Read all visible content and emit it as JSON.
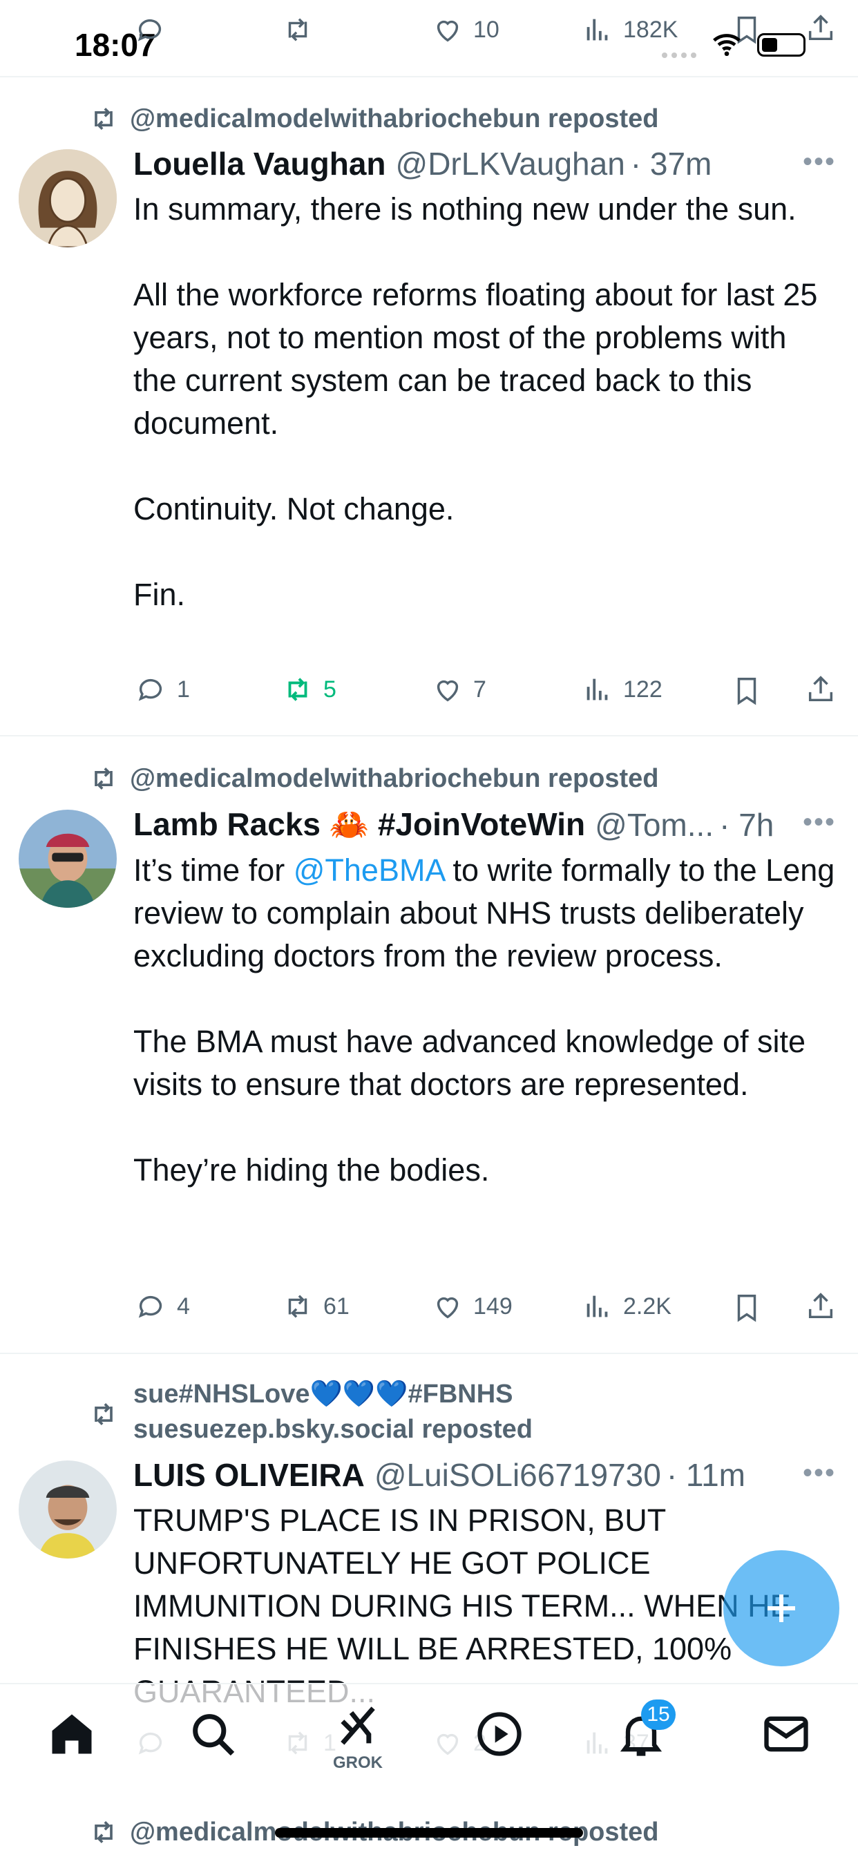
{
  "status_bar": {
    "time": "18:07"
  },
  "top_actions": {
    "likes": "10",
    "views": "182K"
  },
  "posts": [
    {
      "reposted_by": "@medicalmodelwithabriochebun reposted",
      "name": "Louella Vaughan",
      "handle": "@DrLKVaughan",
      "time": "· 37m",
      "text": "In summary, there is nothing new under the sun.\n\nAll the workforce reforms floating about for last 25 years, not to mention most of the problems with the current system can be traced back to this document.\n\nContinuity. Not change.\n\nFin.",
      "replies": "1",
      "reposts": "5",
      "likes": "7",
      "views": "122"
    },
    {
      "reposted_by": "@medicalmodelwithabriochebun reposted",
      "name": "Lamb Racks 🦀 #JoinVoteWin",
      "handle": "@Tom...",
      "time": "· 7h",
      "text_prefix": "It’s time for ",
      "mention": "@TheBMA",
      "text_suffix": " to write formally to the Leng review to complain about NHS trusts deliberately excluding doctors from the review process.\n\nThe BMA must have advanced knowledge of site visits to ensure that doctors are represented.\n\nThey’re hiding the bodies.",
      "replies": "4",
      "reposts": "61",
      "likes": "149",
      "views": "2.2K"
    },
    {
      "reposted_by_line1": "sue#NHSLove💙💙💙#FBNHS",
      "reposted_by_line2": "suesuezep.bsky.social reposted",
      "name": "LUIS OLIVEIRA",
      "handle": "@LuiSOLi66719730",
      "time": "· 11m",
      "text": "TRUMP'S PLACE IS IN PRISON, BUT UNFORTUNATELY HE GOT POLICE IMMUNITION DURING HIS TERM... WHEN HE FINISHES HE WILL BE ARRESTED, 100% GUARANTEED...",
      "replies": "",
      "reposts": "1",
      "likes": "2",
      "views": "37"
    },
    {
      "reposted_by": "@medicalmodelwithabriochebun reposted"
    }
  ],
  "bottom_nav": {
    "grok_label": "GROK",
    "notifications_count": "15"
  },
  "icons": {
    "reply": "reply-icon",
    "repost": "repost-icon",
    "like": "heart-icon",
    "views": "views-icon",
    "bookmark": "bookmark-icon",
    "share": "share-icon",
    "compose": "compose-icon"
  },
  "colors": {
    "accent": "#1d9bf0",
    "repost_green": "#00ba7c",
    "muted": "#536471"
  }
}
